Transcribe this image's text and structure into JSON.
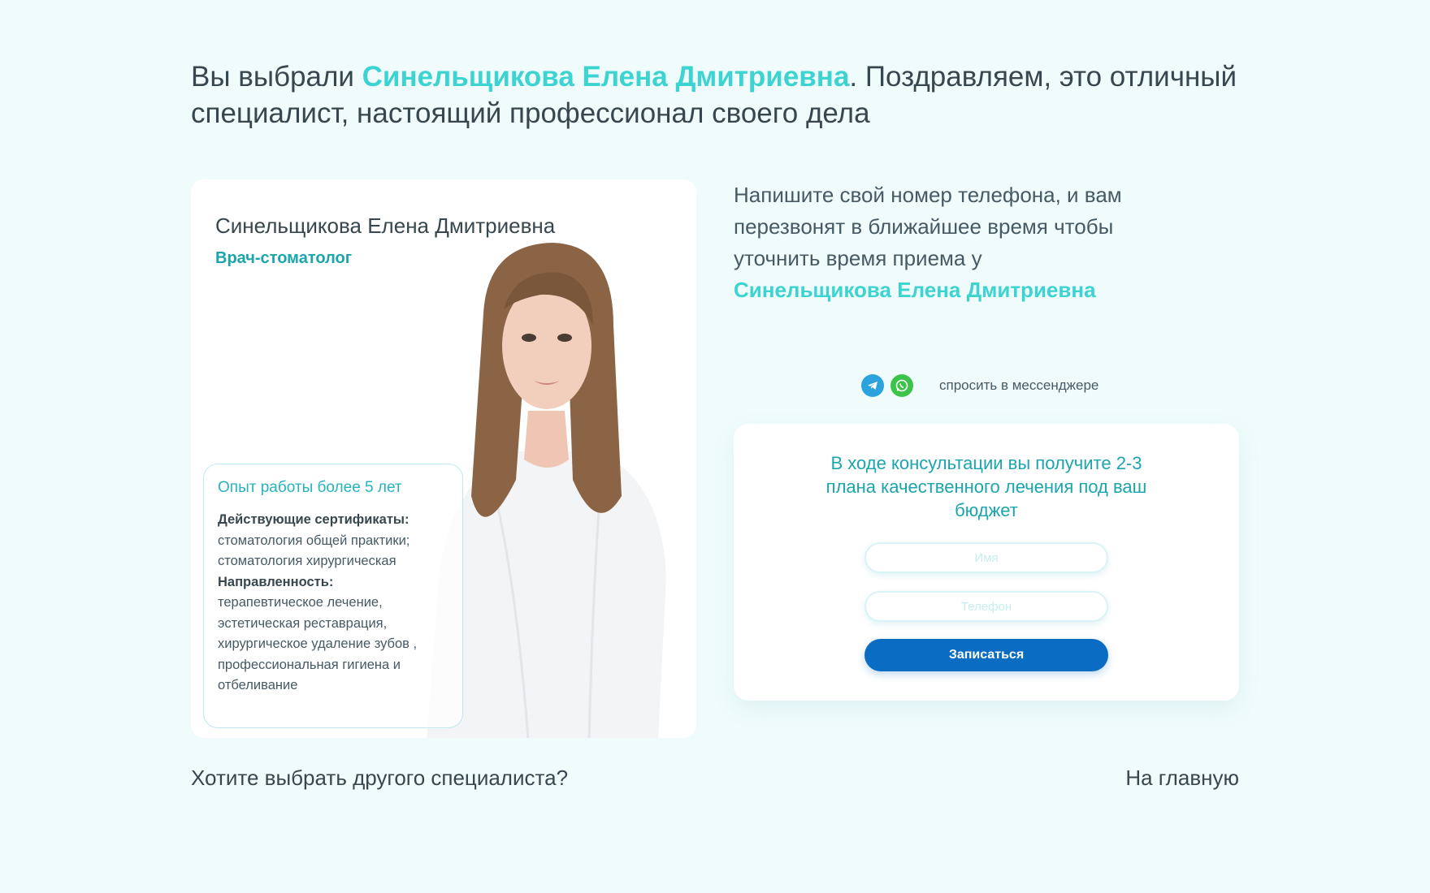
{
  "headline": {
    "prefix": "Вы выбрали ",
    "doctor_name": "Синельщикова Елена Дмитриевна",
    "suffix": ". Поздравляем, это отличный специалист, настоящий профессионал своего дела"
  },
  "doctor_card": {
    "name": "Синельщикова Елена Дмитриевна",
    "role": "Врач-стоматолог",
    "experience": "Опыт работы более 5 лет",
    "certificates_label": "Действующие сертификаты:",
    "certificates_text": "стоматология общей практики; стоматология хирургическая",
    "direction_label": "Направленность:",
    "direction_text": "терапевтическое лечение, эстетическая реставрация, хирургическое удаление зубов , профессиональная гигиена и отбеливание"
  },
  "callback": {
    "text": "Напишите свой номер телефона, и вам перезвонят в ближайшее время чтобы уточнить время приема у",
    "doctor_name": "Синельщикова Елена Дмитриевна"
  },
  "messengers": {
    "label": "спросить в мессенджере",
    "icons": [
      "telegram-icon",
      "whatsapp-icon"
    ],
    "telegram_color": "#2ca3dc",
    "whatsapp_color": "#3ec34a"
  },
  "form": {
    "title": "В ходе консультации вы получите 2-3 плана качественного лечения под ваш бюджет",
    "name_placeholder": "Имя",
    "phone_placeholder": "Телефон",
    "submit_label": "Записаться"
  },
  "footer": {
    "choose_other": "Хотите выбрать другого специалиста?",
    "home": "На главную"
  },
  "colors": {
    "background": "#f0fcfc",
    "accent": "#3dd3d0",
    "teal": "#1ba5ad",
    "button": "#0a6cc2"
  }
}
